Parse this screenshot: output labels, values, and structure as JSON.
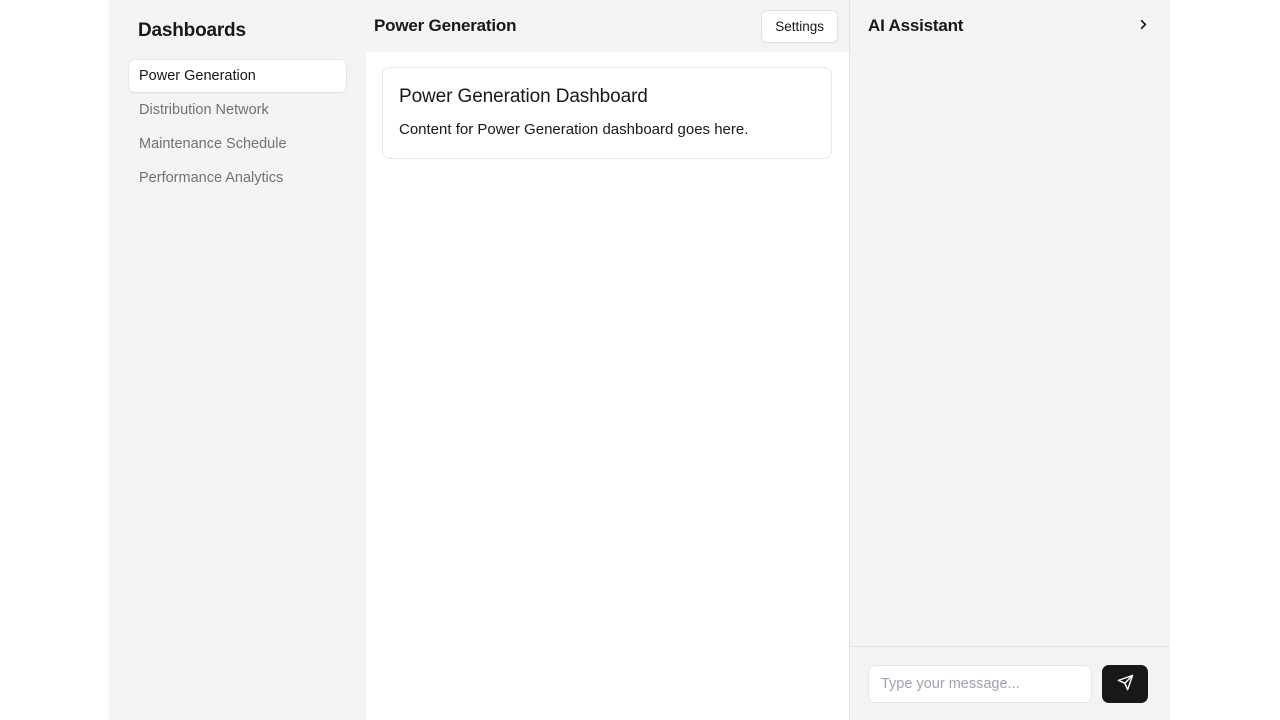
{
  "sidebar": {
    "title": "Dashboards",
    "items": [
      {
        "label": "Power Generation",
        "active": true
      },
      {
        "label": "Distribution Network",
        "active": false
      },
      {
        "label": "Maintenance Schedule",
        "active": false
      },
      {
        "label": "Performance Analytics",
        "active": false
      }
    ]
  },
  "main": {
    "header": {
      "title": "Power Generation",
      "settings_label": "Settings"
    },
    "card": {
      "title": "Power Generation Dashboard",
      "body": "Content for Power Generation dashboard goes here."
    }
  },
  "ai_panel": {
    "title": "AI Assistant",
    "collapse_icon": "chevron-right-icon",
    "messages": [],
    "input": {
      "value": "",
      "placeholder": "Type your message..."
    },
    "send_icon": "send-icon"
  },
  "colors": {
    "panel_bg": "#f4f4f5",
    "content_bg": "#ffffff",
    "border": "#e4e4e7",
    "text_primary": "#18181b",
    "text_muted": "#71717a",
    "placeholder": "#9ca3af",
    "send_button_bg": "#18181b"
  }
}
